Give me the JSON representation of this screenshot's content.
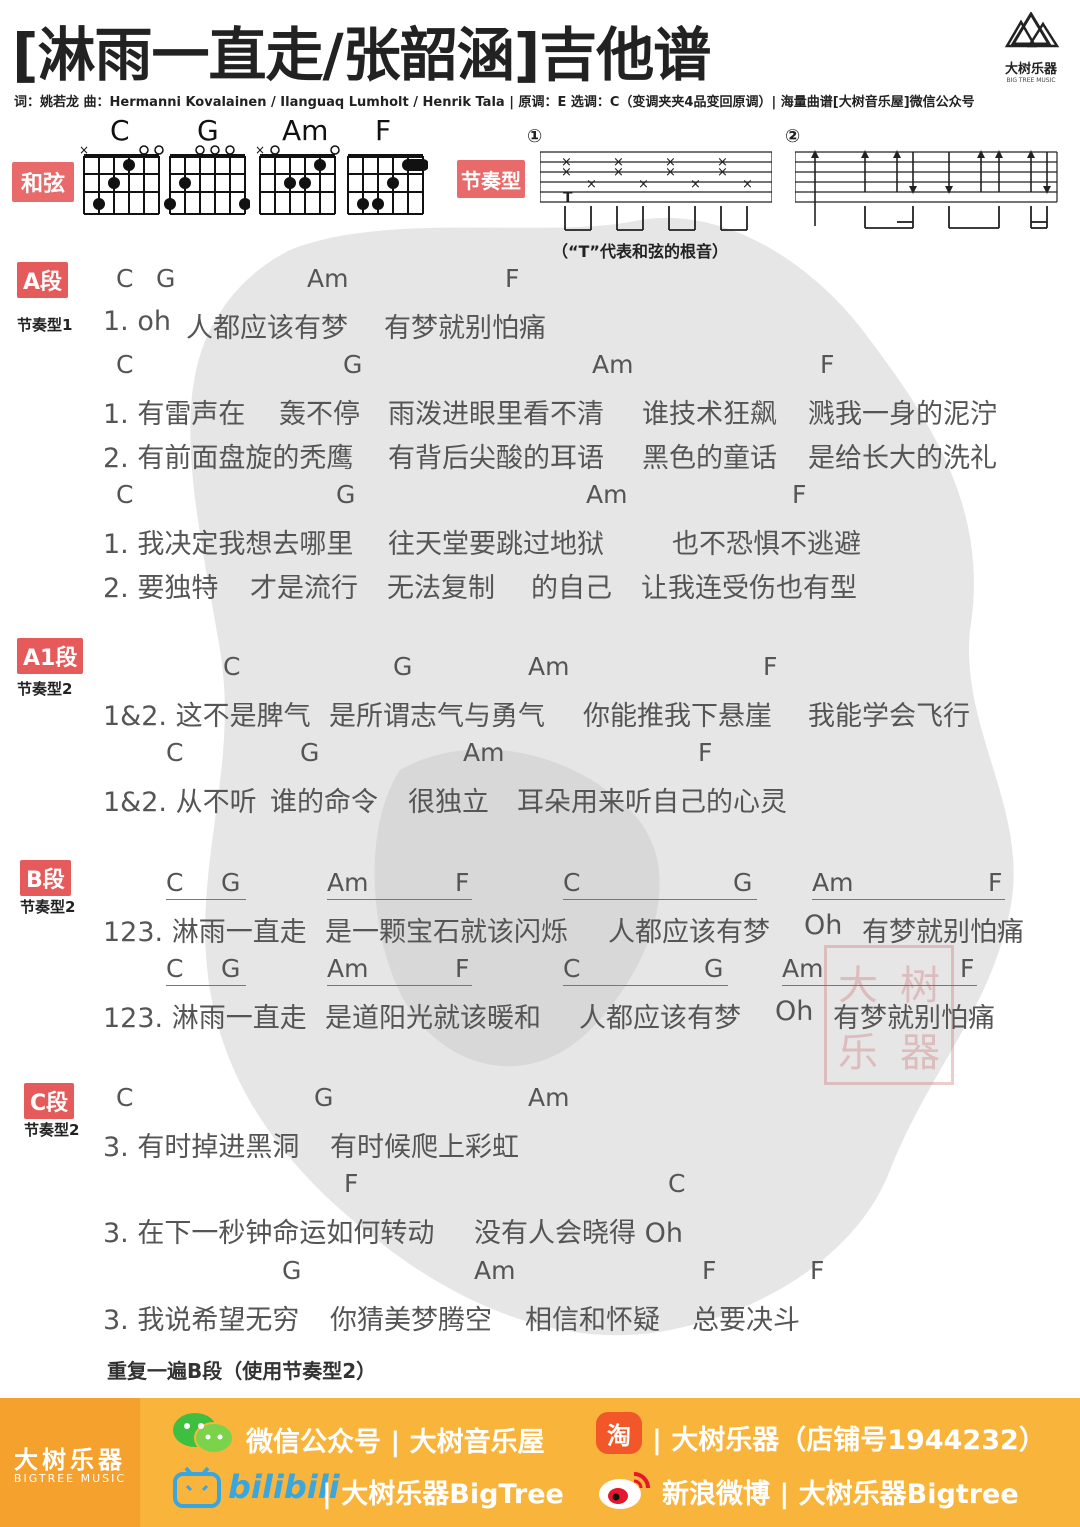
{
  "header": {
    "title": "[淋雨一直走/张韶涵]吉他谱",
    "logo_cn": "大树乐器",
    "logo_en": "BIG TREE MUSIC",
    "credits": "词：姚若龙 曲：Hermanni Kovalainen / Ilanguaq Lumholt / Henrik Tala | 原调：E 选调：C（变调夹夹4品变回原调）| 海量曲谱[大树音乐屋]微信公众号"
  },
  "chords_panel": {
    "label": "和弦",
    "chords": [
      "C",
      "G",
      "Am",
      "F"
    ]
  },
  "rhythm_panel": {
    "label": "节奏型",
    "pattern1_num": "①",
    "pattern2_num": "②",
    "t_mark": "T",
    "note": "（“T”代表和弦的根音）"
  },
  "sections": {
    "a": {
      "label": "A段",
      "rhythm": "节奏型1",
      "l1_chords": [
        "C",
        "G",
        "Am",
        "F"
      ],
      "l1_lyrics": [
        "1. oh",
        "人都应该有梦",
        "有梦就别怕痛"
      ],
      "l2_chords": [
        "C",
        "G",
        "Am",
        "F"
      ],
      "l2_lyrics_v1": [
        "1. 有雷声在",
        "轰不停",
        "雨泼进眼里看不清",
        "谁技术狂飙",
        "溅我一身的泥泞"
      ],
      "l2_lyrics_v2": [
        "2. 有前面盘旋的秃鹰",
        "有背后尖酸的耳语",
        "黑色的童话",
        "是给长大的洗礼"
      ],
      "l3_chords": [
        "C",
        "G",
        "Am",
        "F"
      ],
      "l3_lyrics_v1": [
        "1. 我决定我想去哪里",
        "往天堂要跳过地狱",
        "也不恐惧不逃避"
      ],
      "l3_lyrics_v2": [
        "2. 要独特",
        "才是流行",
        "无法复制",
        "的自己",
        "让我连受伤也有型"
      ]
    },
    "a1": {
      "label": "A1段",
      "rhythm": "节奏型2",
      "l1_chords": [
        "C",
        "G",
        "Am",
        "F"
      ],
      "l1_lyrics": [
        "1&2. 这不是脾气",
        "是所谓志气与勇气",
        "你能推我下悬崖",
        "我能学会飞行"
      ],
      "l2_chords": [
        "C",
        "G",
        "Am",
        "F"
      ],
      "l2_lyrics": [
        "1&2. 从不听",
        "谁的命令",
        "很独立",
        "耳朵用来听自己的心灵"
      ]
    },
    "b": {
      "label": "B段",
      "rhythm": "节奏型2",
      "l1_chords": [
        "C",
        "G",
        "Am",
        "F",
        "C",
        "G",
        "Am",
        "F"
      ],
      "l1_lyrics": [
        "123. 淋雨一直走",
        "是一颗宝石就该闪烁",
        "人都应该有梦",
        "Oh",
        "有梦就别怕痛"
      ],
      "l2_chords": [
        "C",
        "G",
        "Am",
        "F",
        "C",
        "G",
        "Am",
        "F"
      ],
      "l2_lyrics": [
        "123. 淋雨一直走",
        "是道阳光就该暖和",
        "人都应该有梦",
        "Oh",
        "有梦就别怕痛"
      ]
    },
    "c": {
      "label": "C段",
      "rhythm": "节奏型2",
      "l1_chords": [
        "C",
        "G",
        "Am"
      ],
      "l1_lyrics": [
        "3. 有时掉进黑洞",
        "有时候爬上彩虹"
      ],
      "l2_chords": [
        "F",
        "C"
      ],
      "l2_lyrics": [
        "3. 在下一秒钟命运如何转动",
        "没有人会晓得 Oh"
      ],
      "l3_chords": [
        "G",
        "Am",
        "F",
        "F"
      ],
      "l3_lyrics": [
        "3. 我说希望无穷",
        "你猜美梦腾空",
        "相信和怀疑",
        "总要决斗"
      ]
    }
  },
  "repeat_note": "重复一遍B段（使用节奏型2）",
  "stamp_text": [
    "大",
    "树",
    "乐",
    "器"
  ],
  "footer": {
    "logo_cn": "大树乐器",
    "logo_en": "BIGTREE MUSIC",
    "wechat": "微信公众号 | 大树音乐屋",
    "bilibili": "| 大树乐器BigTree",
    "taobao": "| 大树乐器（店铺号1944232）",
    "weibo": "新浪微博 | 大树乐器Bigtree",
    "taobao_glyph": "淘",
    "bili_word": "bilibili"
  },
  "colors": {
    "badge": "#e55a5a",
    "footer": "#f9b53b",
    "footer_logo": "#f4a12d"
  }
}
